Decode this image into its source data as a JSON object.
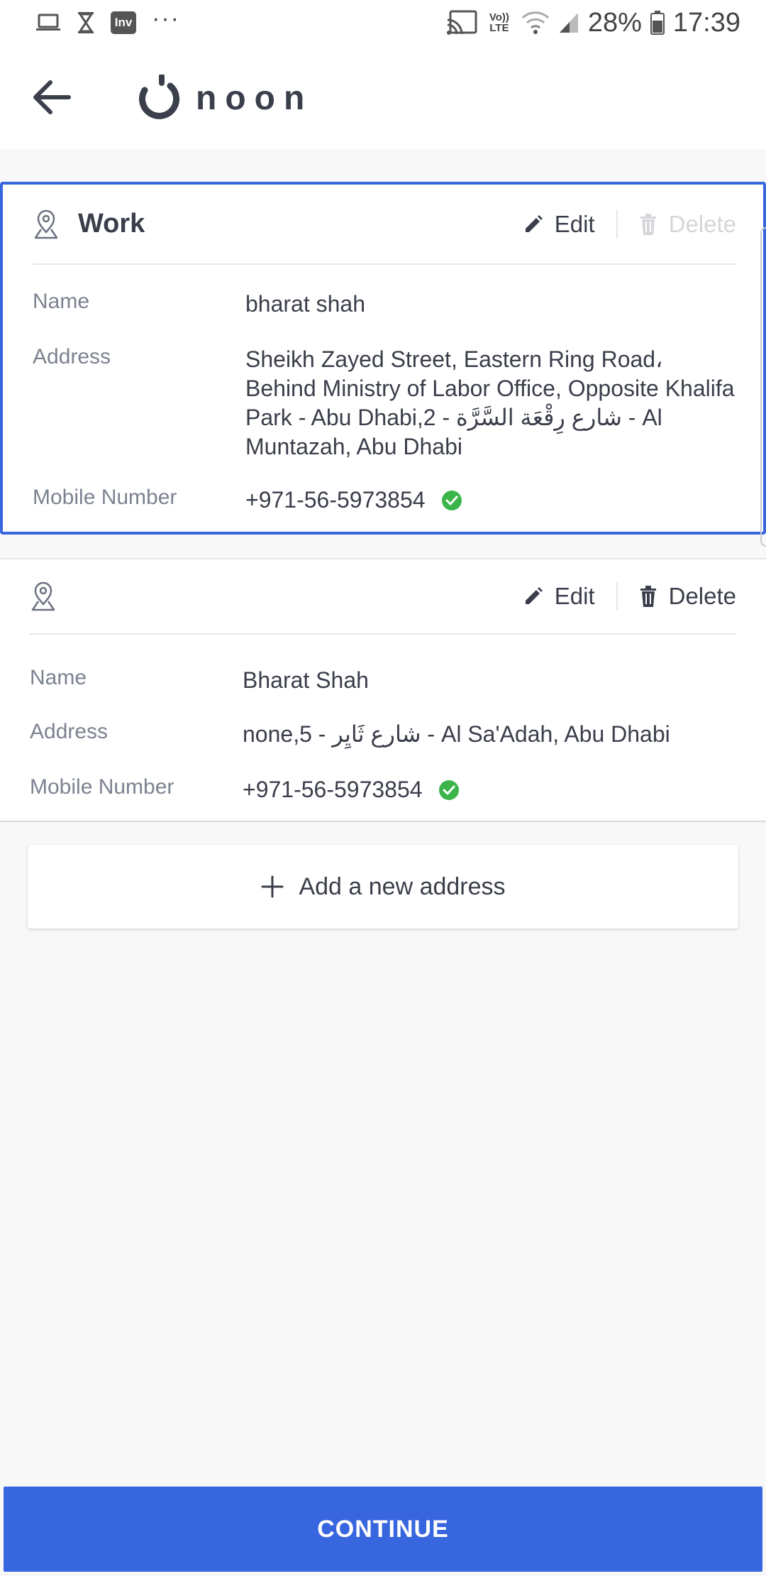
{
  "status_bar": {
    "left_icons": [
      "laptop-icon",
      "hourglass-icon",
      "inv-app-icon",
      "more-dots-icon"
    ],
    "inv_label": "Inv",
    "more": "···",
    "volte_label": "Vo)) LTE",
    "battery": "28%",
    "time": "17:39"
  },
  "header": {
    "logo_text": "noon"
  },
  "addresses": [
    {
      "label": "Work",
      "selected": true,
      "edit_label": "Edit",
      "delete_label": "Delete",
      "delete_enabled": false,
      "fields": {
        "name_label": "Name",
        "name": "bharat shah",
        "address_label": "Address",
        "address": "Sheikh Zayed Street, Eastern Ring Road، Behind Ministry of Labor Office, Opposite Khalifa Park - Abu Dhabi,2 - شارع رِقْعَة السَّرَّة - Al Muntazah, Abu Dhabi",
        "mobile_label": "Mobile Number",
        "mobile": "+971-56-5973854"
      }
    },
    {
      "label": "",
      "selected": false,
      "edit_label": "Edit",
      "delete_label": "Delete",
      "delete_enabled": true,
      "fields": {
        "name_label": "Name",
        "name": "Bharat Shah",
        "address_label": "Address",
        "address": "none,5 - شارع ثَايِر - Al Sa'Adah, Abu Dhabi",
        "mobile_label": "Mobile Number",
        "mobile": "+971-56-5973854"
      }
    }
  ],
  "add_address_label": "Add a new address",
  "continue_label": "CONTINUE",
  "colors": {
    "accent": "#3866df",
    "verified": "#3bb54a",
    "text": "#3a3e4a",
    "muted": "#7c8290"
  }
}
